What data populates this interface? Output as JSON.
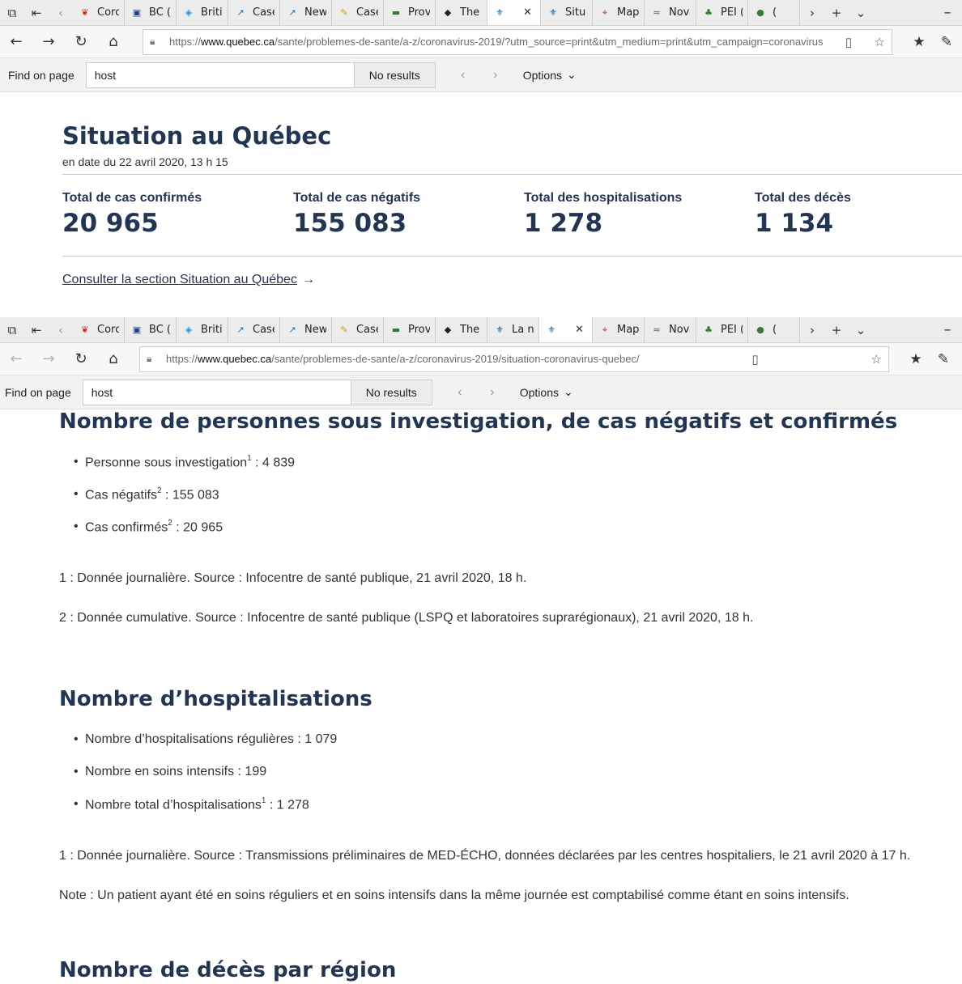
{
  "window1": {
    "tabs": [
      {
        "label": "Corc",
        "favicon": "maple-leaf-icon",
        "color": "#d52b1e"
      },
      {
        "label": "BC (",
        "favicon": "bc-icon",
        "color": "#1f3f7a"
      },
      {
        "label": "Briti",
        "favicon": "british-columbia-icon",
        "color": "#1a9ad6"
      },
      {
        "label": "Case",
        "favicon": "cases-chart-icon",
        "color": "#1a73c9"
      },
      {
        "label": "New",
        "favicon": "news-chart-icon",
        "color": "#1a73c9"
      },
      {
        "label": "Case",
        "favicon": "cases-doc-icon",
        "color": "#c8a000"
      },
      {
        "label": "Prov",
        "favicon": "province-icon",
        "color": "#2e7d32"
      },
      {
        "label": "The",
        "favicon": "shield-icon",
        "color": "#222222"
      },
      {
        "label": "",
        "favicon": "quebec-fleur-icon",
        "color": "#095797",
        "active": true
      },
      {
        "label": "Situ",
        "favicon": "quebec-fleur-icon",
        "color": "#095797"
      },
      {
        "label": "Map",
        "favicon": "map-icon",
        "color": "#c62828"
      },
      {
        "label": "Nov",
        "favicon": "nova-scotia-icon",
        "color": "#555555"
      },
      {
        "label": "PEI (",
        "favicon": "pei-icon",
        "color": "#2e7d32"
      },
      {
        "label": "(",
        "favicon": "globe-icon",
        "color": "#3a7a3a"
      }
    ],
    "url": {
      "prefix": "https://",
      "host": "www.quebec.ca",
      "path": "/sante/problemes-de-sante/a-z/coronavirus-2019/?utm_source=print&utm_medium=print&utm_campaign=coronavirus"
    },
    "find": {
      "label": "Find on page",
      "query": "host",
      "result": "No results",
      "options": "Options"
    },
    "page": {
      "title": "Situation au Québec",
      "date": "en date du 22 avril 2020, 13 h 15",
      "stats": [
        {
          "label": "Total de cas confirmés",
          "value": "20 965"
        },
        {
          "label": "Total de cas négatifs",
          "value": "155 083"
        },
        {
          "label": "Total des hospitalisations",
          "value": "1 278"
        },
        {
          "label": "Total des décès",
          "value": "1 134"
        }
      ],
      "consult_link": "Consulter la section Situation au Québec"
    }
  },
  "window2": {
    "tabs": [
      {
        "label": "Corc",
        "favicon": "maple-leaf-icon",
        "color": "#d52b1e"
      },
      {
        "label": "BC (",
        "favicon": "bc-icon",
        "color": "#1f3f7a"
      },
      {
        "label": "Briti",
        "favicon": "british-columbia-icon",
        "color": "#1a9ad6"
      },
      {
        "label": "Case",
        "favicon": "cases-chart-icon",
        "color": "#1a73c9"
      },
      {
        "label": "New",
        "favicon": "news-chart-icon",
        "color": "#1a73c9"
      },
      {
        "label": "Case",
        "favicon": "cases-doc-icon",
        "color": "#c8a000"
      },
      {
        "label": "Prov",
        "favicon": "province-icon",
        "color": "#2e7d32"
      },
      {
        "label": "The",
        "favicon": "shield-icon",
        "color": "#222222"
      },
      {
        "label": "La n",
        "favicon": "quebec-fleur-icon",
        "color": "#095797"
      },
      {
        "label": "",
        "favicon": "quebec-fleur-icon",
        "color": "#095797",
        "active": true
      },
      {
        "label": "Map",
        "favicon": "map-icon",
        "color": "#c62828"
      },
      {
        "label": "Nov",
        "favicon": "nova-scotia-icon",
        "color": "#555555"
      },
      {
        "label": "PEI (",
        "favicon": "pei-icon",
        "color": "#2e7d32"
      },
      {
        "label": "(",
        "favicon": "globe-icon",
        "color": "#3a7a3a"
      }
    ],
    "url": {
      "prefix": "https://",
      "host": "www.quebec.ca",
      "path": "/sante/problemes-de-sante/a-z/coronavirus-2019/situation-coronavirus-quebec/"
    },
    "find": {
      "label": "Find on page",
      "query": "host",
      "result": "No results",
      "options": "Options"
    },
    "page": {
      "section1": {
        "title": "Nombre de personnes sous investigation, de cas négatifs et confirmés",
        "items": [
          {
            "label": "Personne sous investigation",
            "sup": "1",
            "value": " : 4 839"
          },
          {
            "label": "Cas négatifs",
            "sup": "2",
            "value": " : 155 083"
          },
          {
            "label": "Cas confirmés",
            "sup": "2",
            "value": " : 20 965"
          }
        ],
        "notes": [
          "1 : Donnée journalière. Source : Infocentre de santé publique, 21 avril 2020, 18 h.",
          "2 : Donnée cumulative. Source : Infocentre de santé publique (LSPQ et laboratoires suprarégionaux), 21 avril 2020, 18 h."
        ]
      },
      "section2": {
        "title": "Nombre d’hospitalisations",
        "items": [
          {
            "label": "Nombre d’hospitalisations régulières : 1 079",
            "sup": "",
            "value": ""
          },
          {
            "label": "Nombre en soins intensifs : 199",
            "sup": "",
            "value": ""
          },
          {
            "label": "Nombre total d’hospitalisations",
            "sup": "1",
            "value": " : 1 278"
          }
        ],
        "notes": [
          "1 : Donnée journalière. Source : Transmissions préliminaires de MED-ÉCHO, données déclarées par les centres hospitaliers, le 21 avril 2020 à 17 h.",
          "Note : Un patient ayant été en soins réguliers et en soins intensifs dans la même journée est comptabilisé comme étant en soins intensifs."
        ]
      },
      "section3": {
        "title": "Nombre de décès par région"
      }
    }
  },
  "colors": {
    "heading": "#223654",
    "text": "#333333",
    "chrome": "#ececec",
    "quebec_blue": "#095797"
  }
}
